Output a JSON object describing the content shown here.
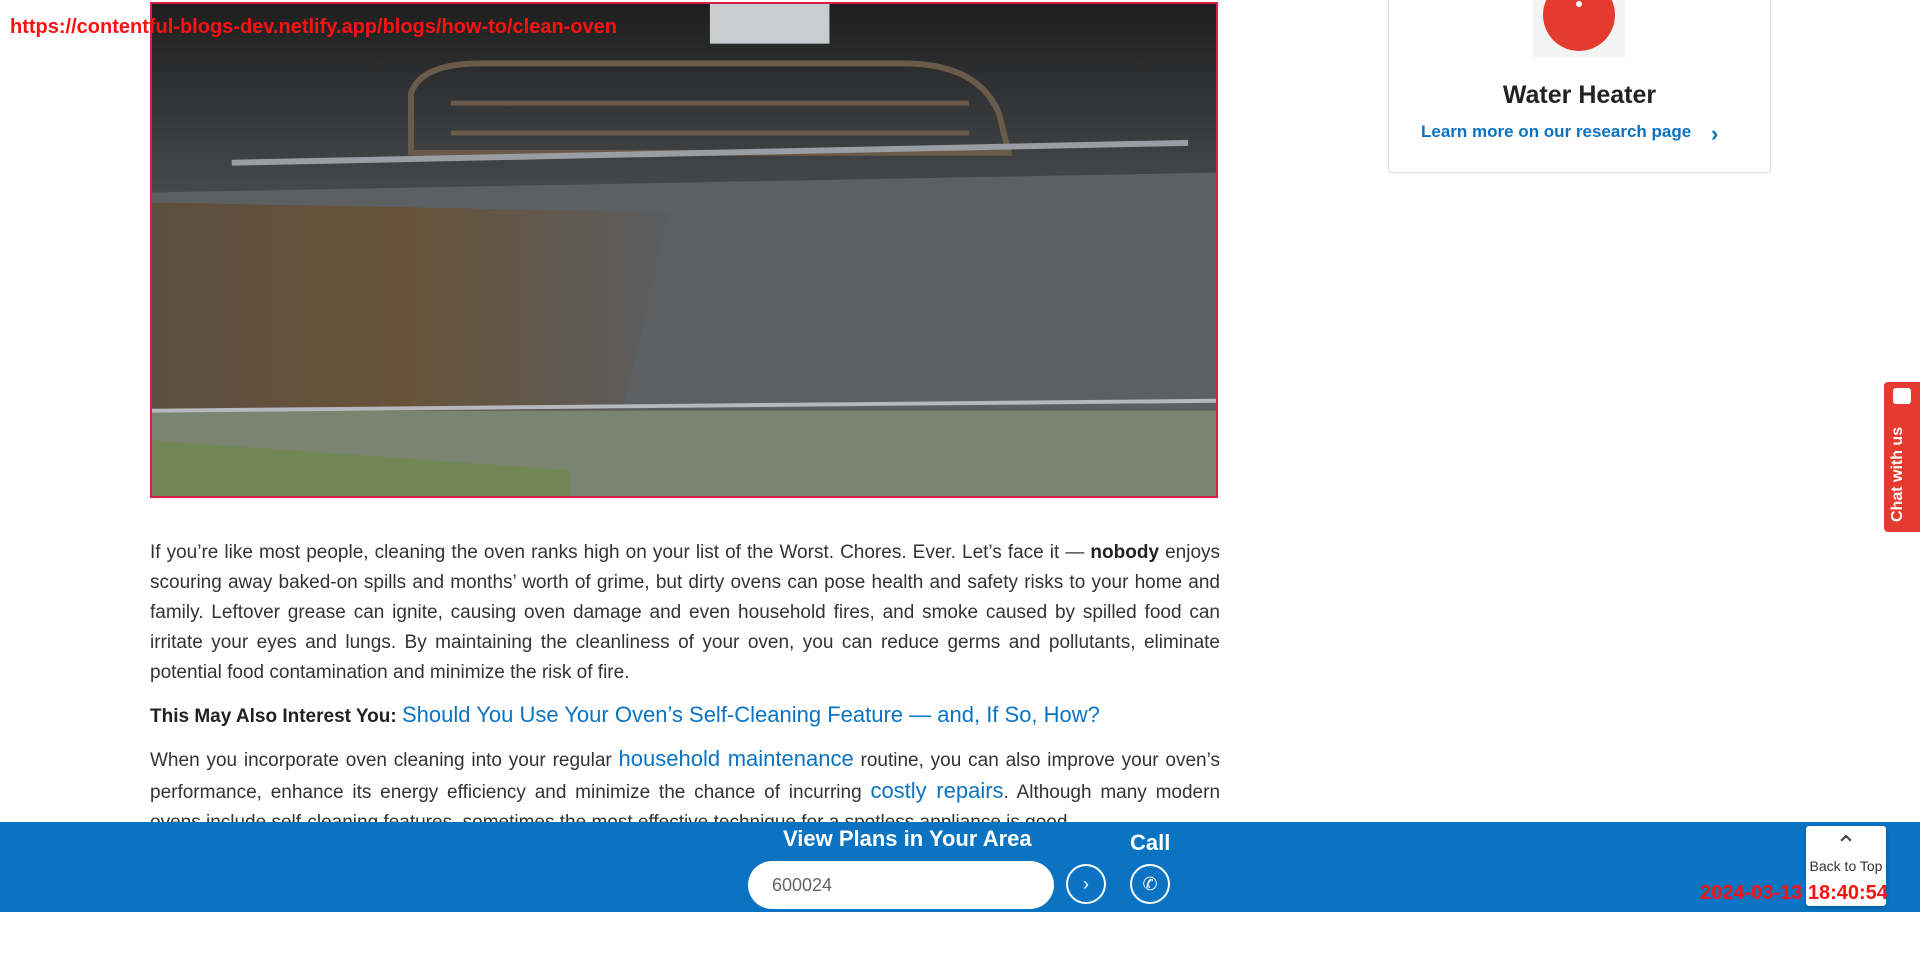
{
  "overlay": {
    "url": "https://contentful-blogs-dev.netlify.app/blogs/how-to/clean-oven",
    "timestamp": "2024-03-13 18:40:54"
  },
  "hero": {
    "icon": "oven-interior-image"
  },
  "sidecard": {
    "title": "Water Heater",
    "link": "Learn more on our research page",
    "icon": "water-heater-icon",
    "accent": "#e53a2f"
  },
  "article": {
    "p1_start": "If you’re like most people, cleaning the oven ranks high on your list of the Worst. Chores. Ever. Let’s face it — ",
    "p1_bold": "nobody",
    "p1_end": " enjoys scouring away baked-on spills and months’ worth of grime, but dirty ovens can pose health and safety risks to your home and family. Leftover grease can ignite, causing oven damage and even household fires, and smoke caused by spilled food can irritate your eyes and lungs. By maintaining the cleanliness of your oven, you can reduce germs and pollutants, eliminate potential food contamination and minimize the risk of fire.",
    "interest_label": "This May Also Interest You: ",
    "interest_link": "Should You Use Your Oven’s Self-Cleaning Feature — and, If So, How?",
    "p2_start": "When you incorporate oven cleaning into your regular ",
    "p2_link1": "household maintenance",
    "p2_mid": " routine, you can also improve your oven’s performance, enhance its energy efficiency and minimize the chance of incurring ",
    "p2_link2": "costly repairs",
    "p2_end": ". Although many modern ovens include self-cleaning features, sometimes the most effective technique for a spotless appliance is good"
  },
  "footer": {
    "plans_label": "View Plans in Your Area",
    "zip_value": "600024",
    "call_label": "Call",
    "back_to_top": "Back to Top",
    "brand_color": "#0a73c2"
  },
  "chat": {
    "label": "Chat with us"
  }
}
